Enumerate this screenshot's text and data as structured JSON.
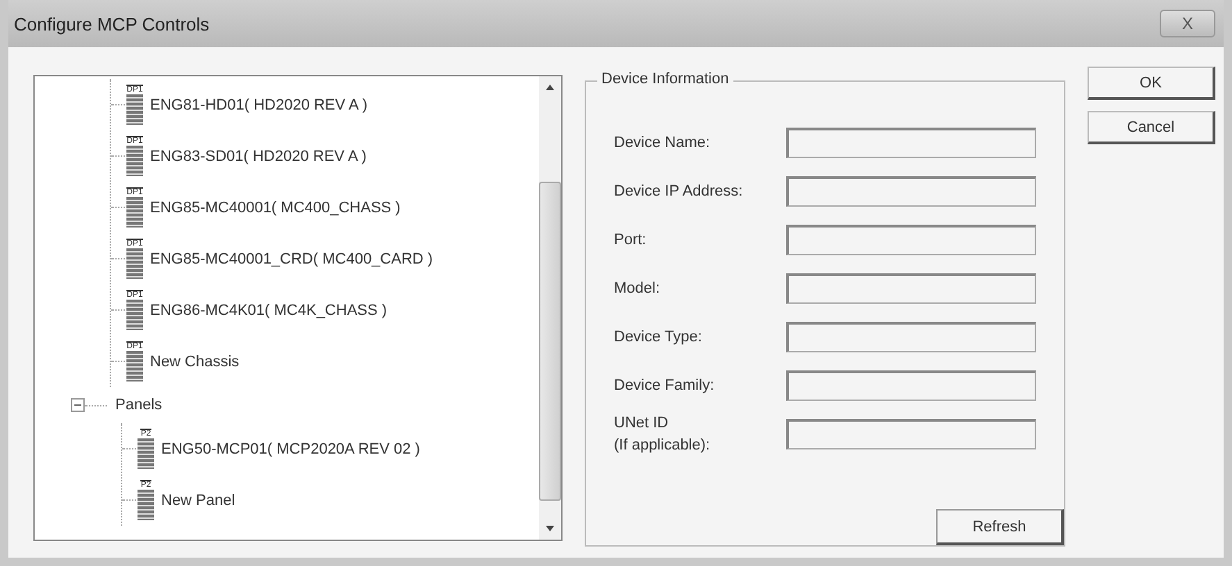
{
  "window": {
    "title": "Configure MCP Controls",
    "close": "X"
  },
  "tree": {
    "nodes": [
      {
        "children": [
          {
            "label": "ENG81-HD01( HD2020 REV A )",
            "badge": "DP1"
          },
          {
            "label": "ENG83-SD01( HD2020 REV A )",
            "badge": "DP1"
          },
          {
            "label": "ENG85-MC40001( MC400_CHASS )",
            "badge": "DP1"
          },
          {
            "label": "ENG85-MC40001_CRD( MC400_CARD )",
            "badge": "DP1"
          },
          {
            "label": "ENG86-MC4K01( MC4K_CHASS )",
            "badge": "DP1"
          },
          {
            "label": "New Chassis",
            "badge": "DP1"
          }
        ]
      },
      {
        "label": "Panels",
        "expanded": true,
        "children": [
          {
            "label": "ENG50-MCP01( MCP2020A REV 02 )",
            "badge": "P2"
          },
          {
            "label": "New Panel",
            "badge": "P2"
          }
        ]
      }
    ]
  },
  "device_information": {
    "title": "Device Information",
    "fields": [
      {
        "label": "Device Name:"
      },
      {
        "label": "Device IP Address:"
      },
      {
        "label": "Port:"
      },
      {
        "label": "Model:"
      },
      {
        "label": "Device Type:"
      },
      {
        "label": "Device Family:"
      },
      {
        "label": "UNet ID\n(If applicable):"
      }
    ],
    "refresh_button": "Refresh"
  },
  "buttons": [
    "OK",
    "Cancel"
  ]
}
